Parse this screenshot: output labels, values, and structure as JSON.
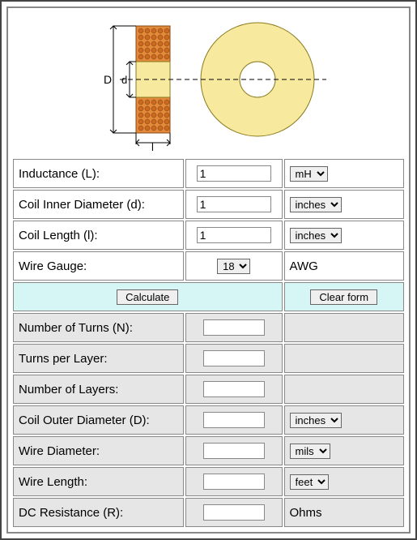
{
  "inputs": {
    "inductance": {
      "label": "Inductance (L):",
      "value": "1",
      "units": [
        "mH"
      ],
      "selected": "mH"
    },
    "inner_diam": {
      "label": "Coil Inner Diameter (d):",
      "value": "1",
      "units": [
        "inches"
      ],
      "selected": "inches"
    },
    "coil_length": {
      "label": "Coil Length (l):",
      "value": "1",
      "units": [
        "inches"
      ],
      "selected": "inches"
    },
    "wire_gauge": {
      "label": "Wire Gauge:",
      "options": [
        "18"
      ],
      "selected": "18",
      "unit_text": "AWG"
    }
  },
  "buttons": {
    "calculate": "Calculate",
    "clear": "Clear form"
  },
  "outputs": {
    "turns": {
      "label": "Number of Turns (N):",
      "value": "",
      "unit_text": ""
    },
    "tpl": {
      "label": "Turns per Layer:",
      "value": "",
      "unit_text": ""
    },
    "layers": {
      "label": "Number of Layers:",
      "value": "",
      "unit_text": ""
    },
    "outer_diam": {
      "label": "Coil Outer Diameter (D):",
      "value": "",
      "units": [
        "inches"
      ],
      "selected": "inches"
    },
    "wire_diam": {
      "label": "Wire Diameter:",
      "value": "",
      "units": [
        "mils"
      ],
      "selected": "mils"
    },
    "wire_len": {
      "label": "Wire Length:",
      "value": "",
      "units": [
        "feet"
      ],
      "selected": "feet"
    },
    "dc_res": {
      "label": "DC Resistance (R):",
      "value": "",
      "unit_text": "Ohms"
    }
  },
  "diagram": {
    "labels": {
      "D": "D",
      "d": "d",
      "l": "l"
    }
  }
}
